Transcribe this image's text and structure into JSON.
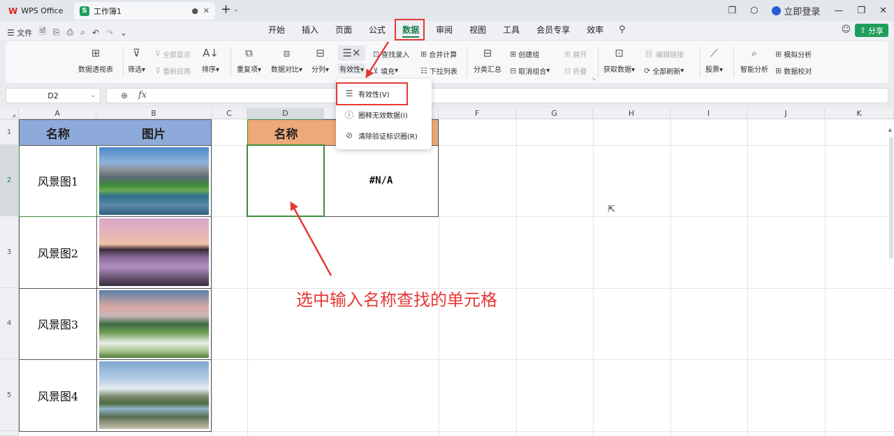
{
  "titlebar": {
    "app_tab": "WPS Office",
    "doc_tab": "工作簿1",
    "doc_icon_letter": "S",
    "login": "立即登录"
  },
  "menubar": {
    "file": "文件",
    "tabs": [
      "开始",
      "插入",
      "页面",
      "公式",
      "数据",
      "审阅",
      "视图",
      "工具",
      "会员专享",
      "效率"
    ],
    "active_tab": "数据",
    "share": "分享"
  },
  "ribbon": {
    "pivot": "数据透视表",
    "filter": "筛选",
    "show_all": "全部显示",
    "reapply": "重新应用",
    "sort": "排序",
    "duplicates": "重复项",
    "compare": "数据对比",
    "split": "分列",
    "validity": "有效性",
    "lookup_entry": "查找录入",
    "fill": "填充",
    "merge_calc": "合并计算",
    "dropdown_list": "下拉列表",
    "subtotal": "分类汇总",
    "create_group": "创建组",
    "ungroup": "取消组合",
    "expand": "展开",
    "collapse": "折叠",
    "get_data": "获取数据",
    "edit_links": "编辑链接",
    "refresh_all": "全部刷新",
    "stocks": "股票",
    "smart_analysis": "智能分析",
    "what_if": "模拟分析",
    "data_check": "数据校对"
  },
  "formula_bar": {
    "name_box": "D2",
    "fx": "fx",
    "content": ""
  },
  "grid": {
    "columns": [
      "A",
      "B",
      "C",
      "D",
      "E",
      "F",
      "G",
      "H",
      "I",
      "J",
      "K"
    ],
    "rows": [
      "1",
      "2",
      "3",
      "4",
      "5"
    ],
    "header_a": "名称",
    "header_b": "图片",
    "header_d": "名称",
    "names": [
      "风景图1",
      "风景图2",
      "风景图3",
      "风景图4"
    ],
    "e2_value": "#N/A"
  },
  "dropdown": {
    "items": [
      "有效性(V)",
      "圈释无效数据(I)",
      "清除验证标识圈(R)"
    ]
  },
  "annotation": {
    "text": "选中输入名称查找的单元格",
    "color": "#e53935"
  }
}
